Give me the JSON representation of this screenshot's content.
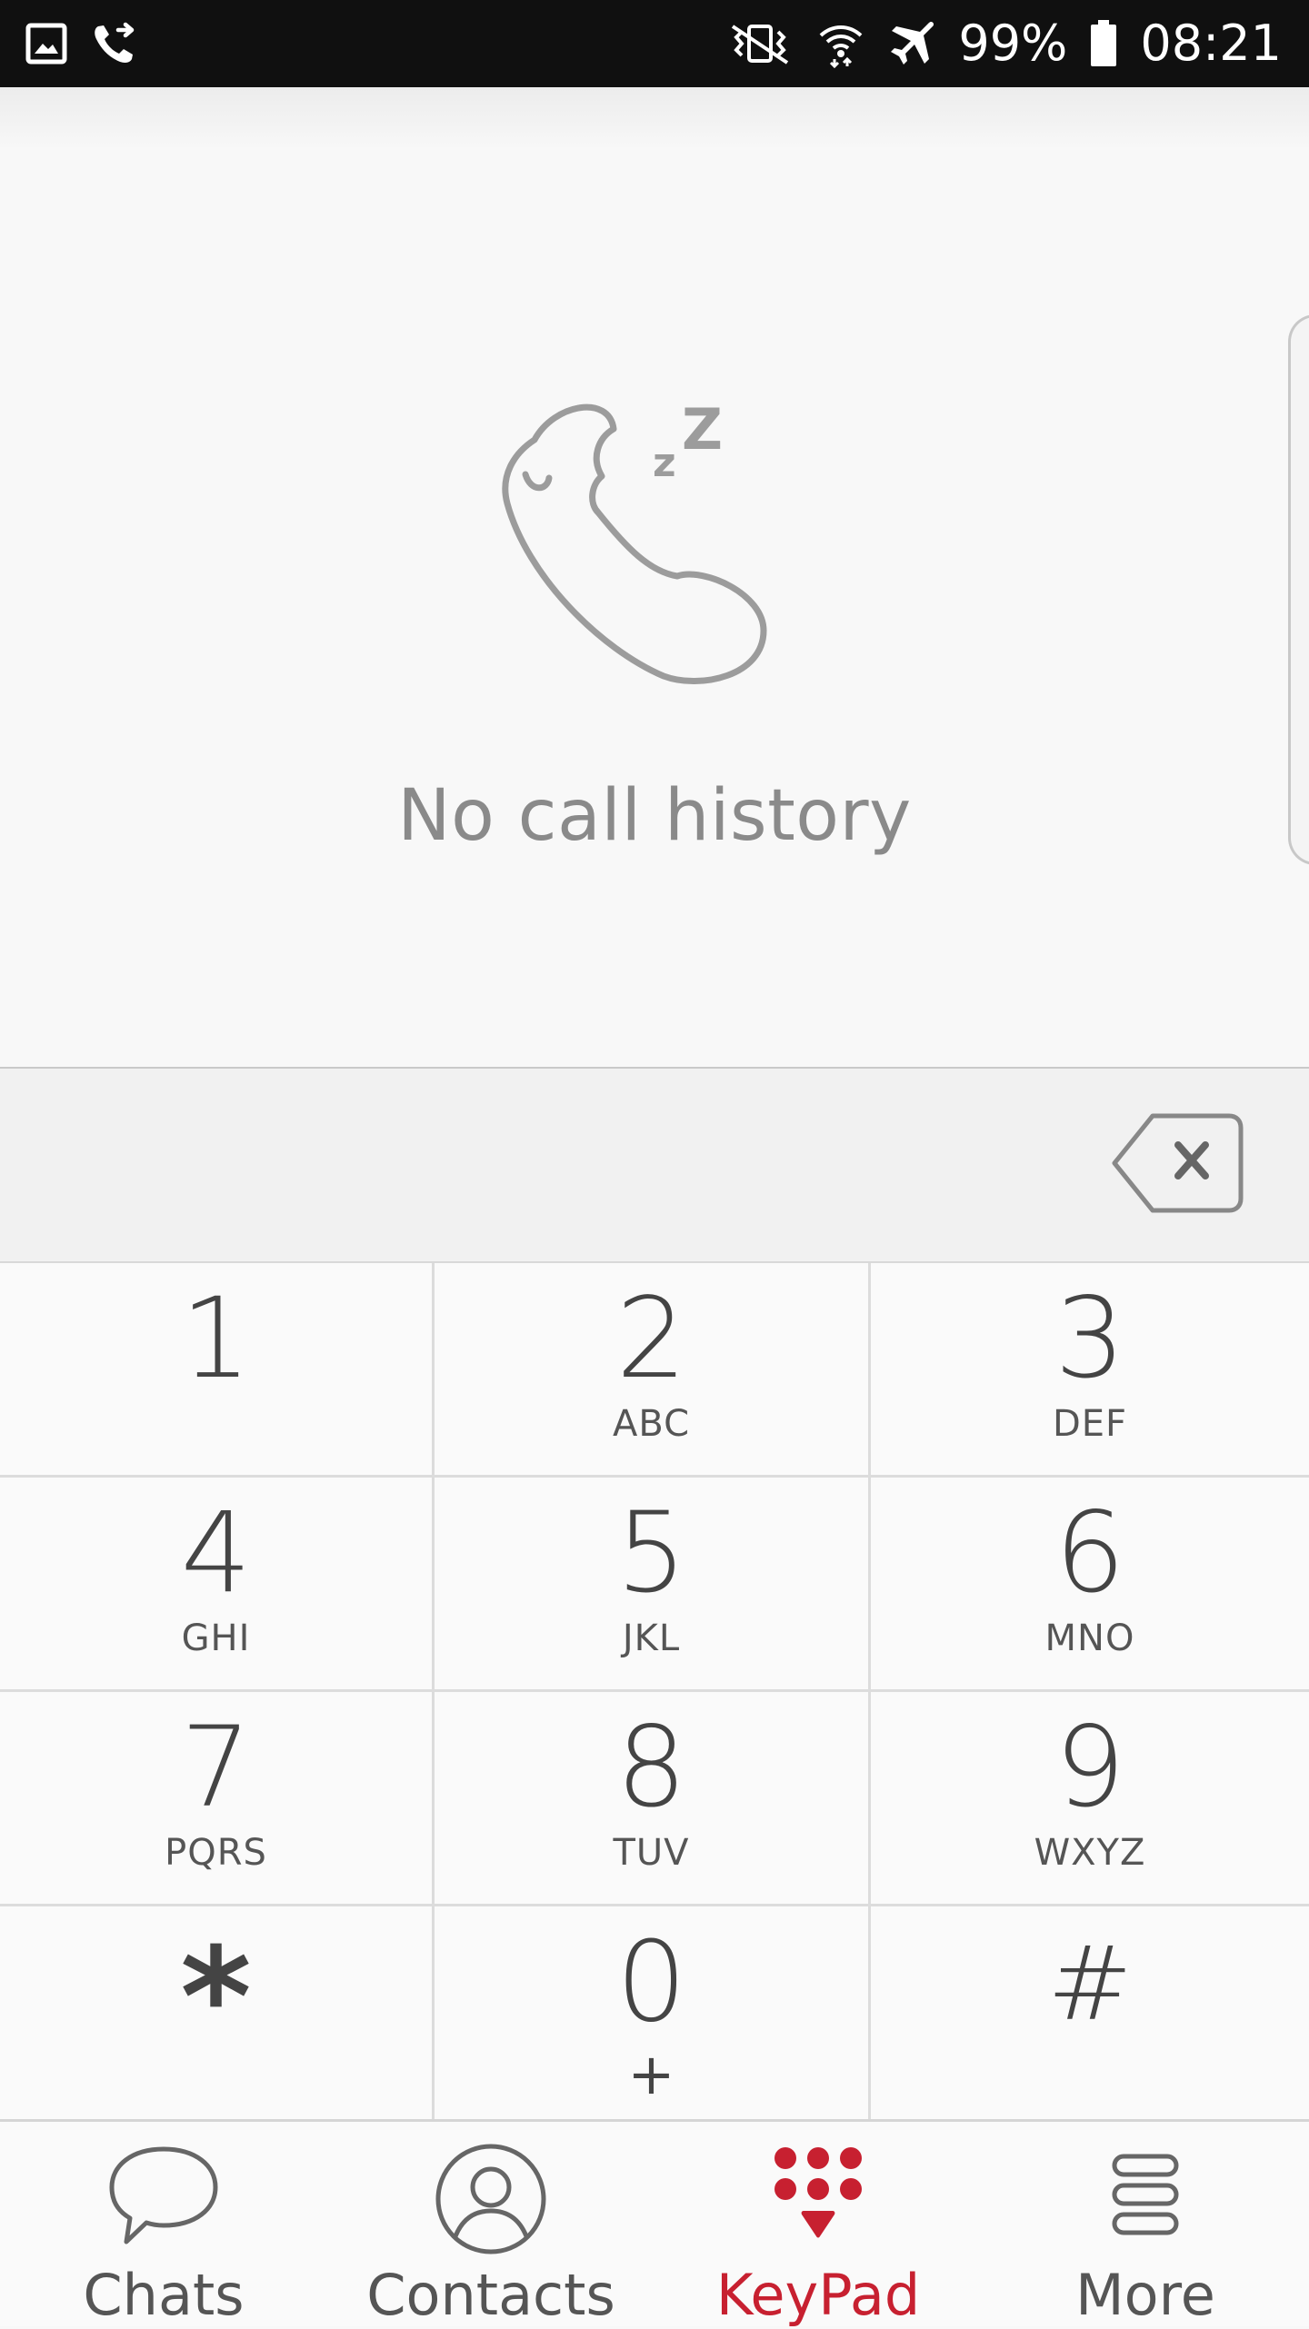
{
  "status_bar": {
    "battery": "99%",
    "time": "08:21",
    "icons": [
      "gallery-icon",
      "call-forward-icon",
      "vibrate-icon",
      "wifi-icon",
      "airplane-icon",
      "battery-icon"
    ]
  },
  "call_log": {
    "empty_message": "No call history",
    "illustration": "sleeping-phone-icon"
  },
  "dialer": {
    "number": "",
    "backspace_icon": "backspace-icon"
  },
  "keypad": {
    "keys": [
      {
        "digit": "1",
        "letters": ""
      },
      {
        "digit": "2",
        "letters": "ABC"
      },
      {
        "digit": "3",
        "letters": "DEF"
      },
      {
        "digit": "4",
        "letters": "GHI"
      },
      {
        "digit": "5",
        "letters": "JKL"
      },
      {
        "digit": "6",
        "letters": "MNO"
      },
      {
        "digit": "7",
        "letters": "PQRS"
      },
      {
        "digit": "8",
        "letters": "TUV"
      },
      {
        "digit": "9",
        "letters": "WXYZ"
      },
      {
        "digit": "*",
        "letters": ""
      },
      {
        "digit": "0",
        "letters": "+"
      },
      {
        "digit": "#",
        "letters": ""
      }
    ]
  },
  "bottom_nav": {
    "active": "KeyPad",
    "accent_color": "#c72030",
    "items": [
      {
        "label": "Chats",
        "icon": "chat-bubble-icon"
      },
      {
        "label": "Contacts",
        "icon": "contact-person-icon"
      },
      {
        "label": "KeyPad",
        "icon": "keypad-dots-icon"
      },
      {
        "label": "More",
        "icon": "more-menu-icon"
      }
    ]
  }
}
